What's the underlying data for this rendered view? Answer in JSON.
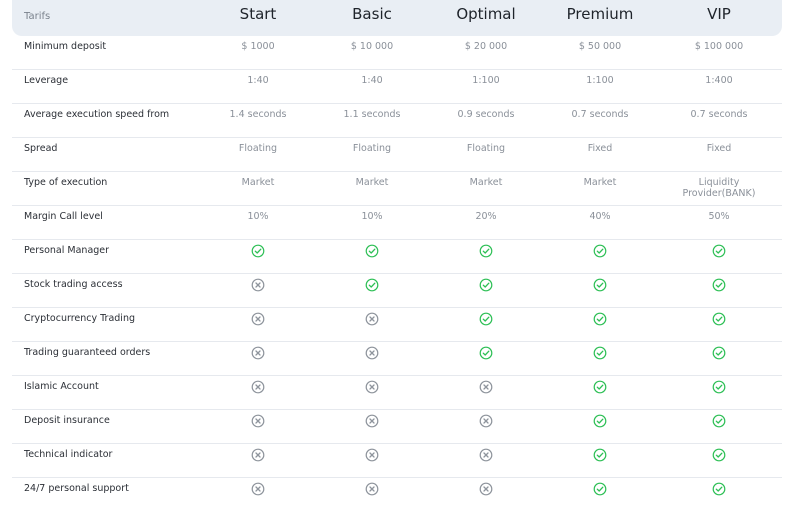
{
  "header": {
    "first_col": "Tarifs",
    "plans": [
      "Start",
      "Basic",
      "Optimal",
      "Premium",
      "VIP"
    ]
  },
  "text_rows": [
    {
      "label": "Minimum deposit",
      "values": [
        "$ 1000",
        "$ 10 000",
        "$ 20 000",
        "$ 50 000",
        "$ 100 000"
      ]
    },
    {
      "label": "Leverage",
      "values": [
        "1:40",
        "1:40",
        "1:100",
        "1:100",
        "1:400"
      ]
    },
    {
      "label": "Average execution speed from",
      "values": [
        "1.4 seconds",
        "1.1 seconds",
        "0.9 seconds",
        "0.7 seconds",
        "0.7 seconds"
      ]
    },
    {
      "label": "Spread",
      "values": [
        "Floating",
        "Floating",
        "Floating",
        "Fixed",
        "Fixed"
      ]
    },
    {
      "label": "Type of execution",
      "values": [
        "Market",
        "Market",
        "Market",
        "Market",
        "Liquidity Provider(BANK)"
      ]
    },
    {
      "label": "Margin Call level",
      "values": [
        "10%",
        "10%",
        "20%",
        "40%",
        "50%"
      ]
    }
  ],
  "feature_rows": [
    {
      "label": "Personal Manager",
      "values": [
        true,
        true,
        true,
        true,
        true
      ]
    },
    {
      "label": "Stock trading access",
      "values": [
        false,
        true,
        true,
        true,
        true
      ]
    },
    {
      "label": "Cryptocurrency Trading",
      "values": [
        false,
        false,
        true,
        true,
        true
      ]
    },
    {
      "label": "Trading guaranteed orders",
      "values": [
        false,
        false,
        true,
        true,
        true
      ]
    },
    {
      "label": "Islamic Account",
      "values": [
        false,
        false,
        false,
        true,
        true
      ]
    },
    {
      "label": "Deposit insurance",
      "values": [
        false,
        false,
        false,
        true,
        true
      ]
    },
    {
      "label": "Technical indicator",
      "values": [
        false,
        false,
        false,
        true,
        true
      ]
    },
    {
      "label": "24/7 personal support",
      "values": [
        false,
        false,
        false,
        true,
        true
      ]
    }
  ],
  "icons": {
    "included": "check-circle-icon",
    "excluded": "x-circle-icon"
  },
  "colors": {
    "included": "#2dbf55",
    "excluded": "#8e949c",
    "header_bg": "#e9eef4"
  }
}
